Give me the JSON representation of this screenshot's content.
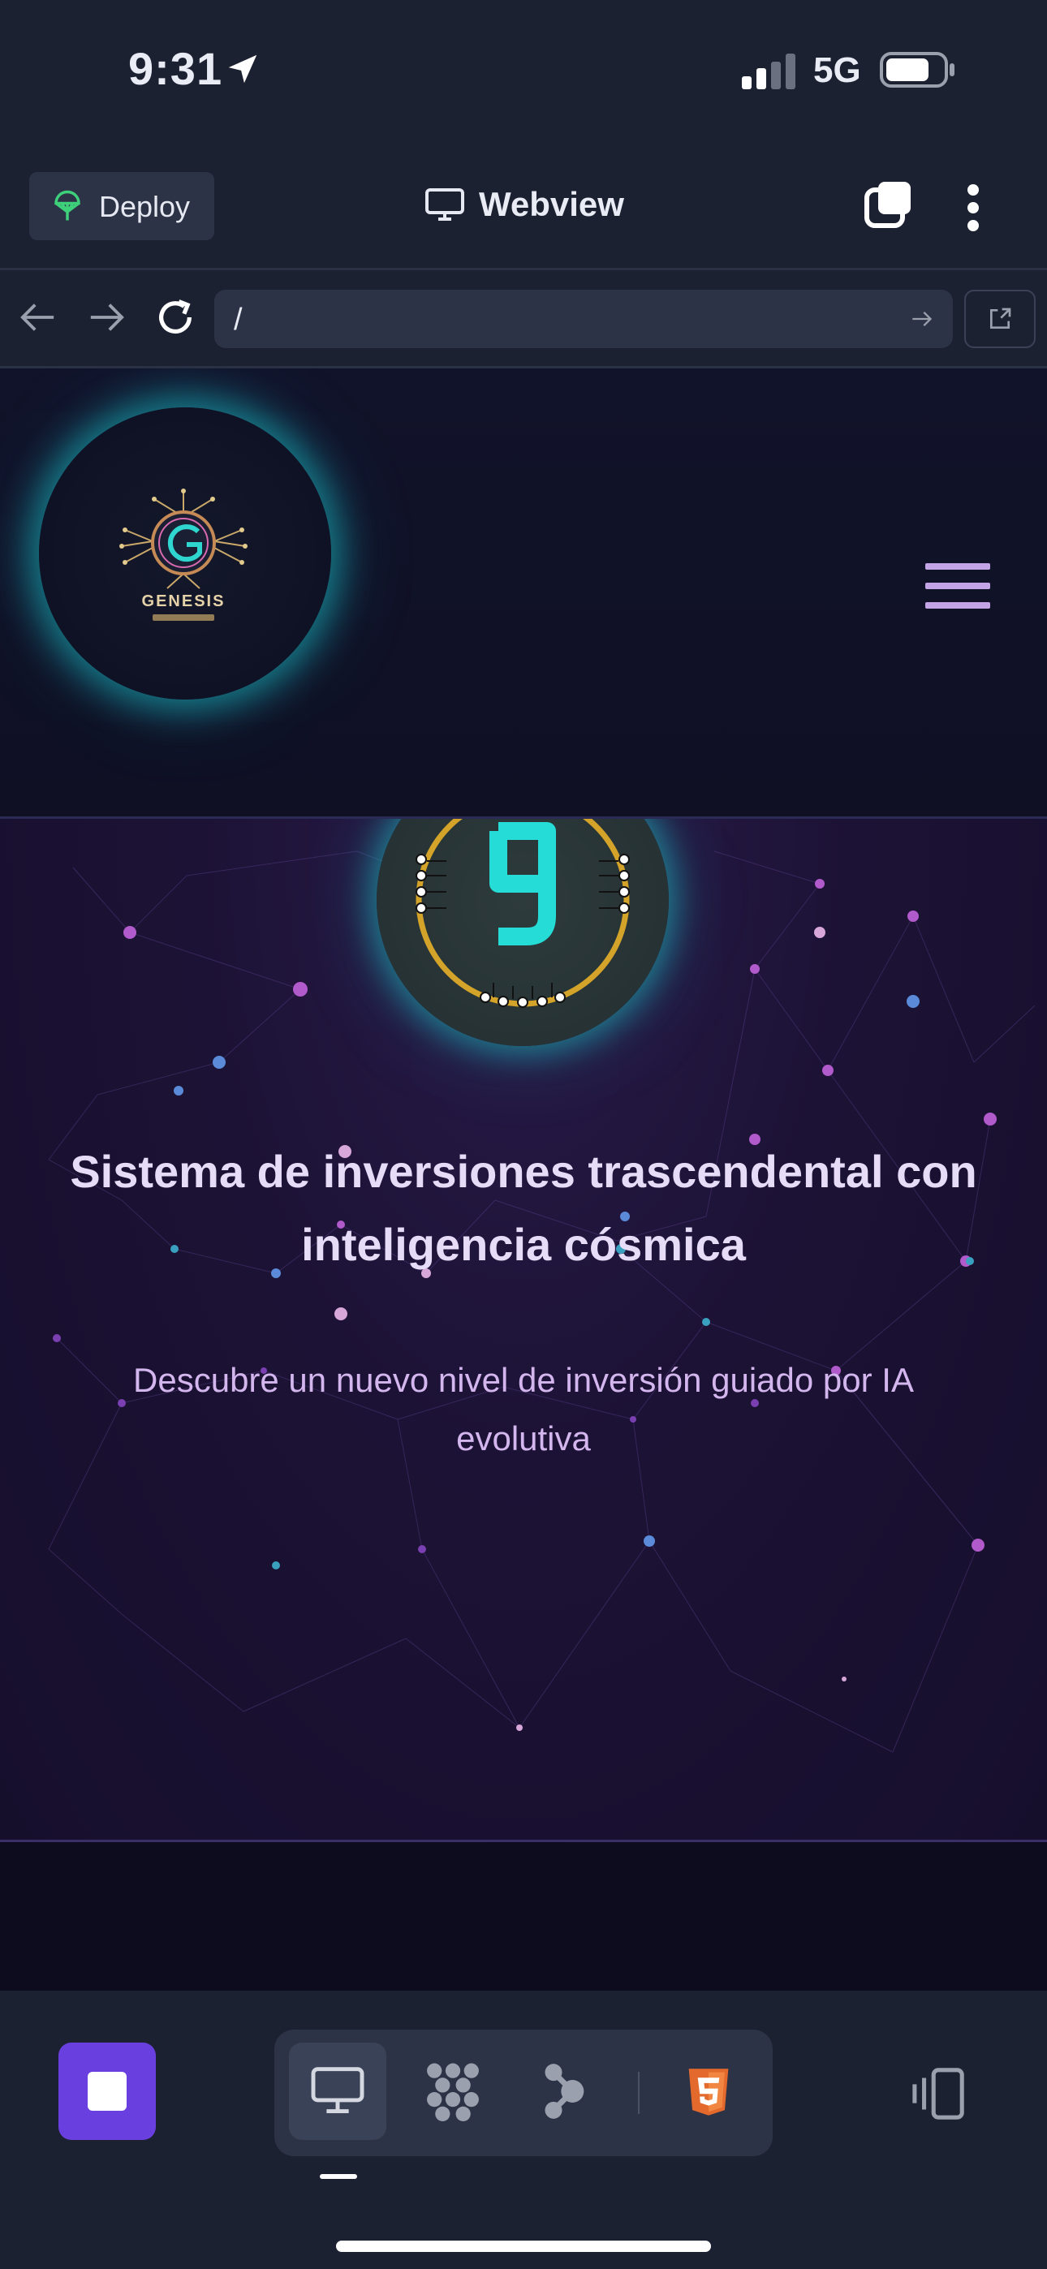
{
  "status_bar": {
    "time": "9:31",
    "network": "5G",
    "icons": [
      "location-arrow-icon",
      "cellular-signal-icon",
      "battery-icon"
    ]
  },
  "toolbar": {
    "deploy_label": "Deploy",
    "title": "Webview",
    "icons": [
      "deploy-icon",
      "monitor-icon",
      "tabs-icon",
      "more-vertical-icon"
    ]
  },
  "url_bar": {
    "url": "/",
    "icons": [
      "back-arrow-icon",
      "forward-arrow-icon",
      "reload-icon",
      "go-arrow-icon",
      "open-external-icon"
    ]
  },
  "site": {
    "logo_text": "GENESIS",
    "menu_icon": "hamburger-menu-icon",
    "hero": {
      "title": "Sistema de inversiones trascendental con inteligencia cósmica",
      "subtitle": "Descubre un nuevo nivel de inversión guiado por IA evolutiva"
    }
  },
  "bottom_bar": {
    "icons": [
      "stop-icon",
      "monitor-icon",
      "grid-dots-icon",
      "flow-icon",
      "html5-icon",
      "devices-icon"
    ],
    "accent": "#6a3fe0"
  }
}
